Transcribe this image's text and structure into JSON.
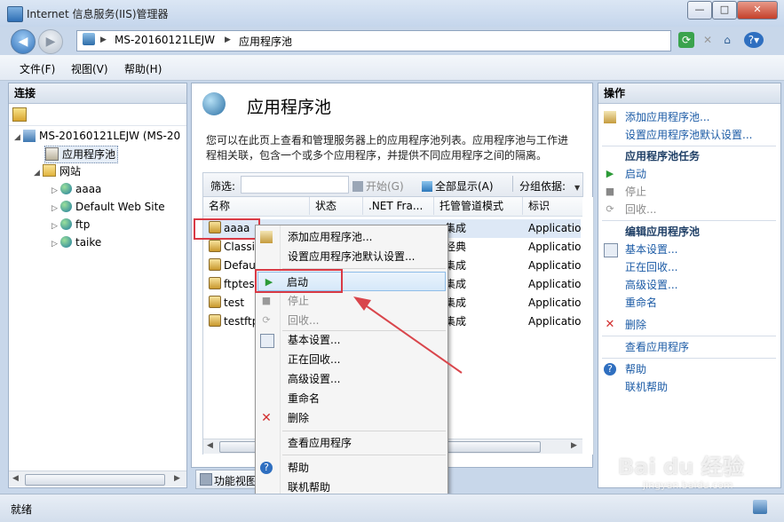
{
  "window": {
    "title": "Internet 信息服务(IIS)管理器",
    "min": "—",
    "max": "□",
    "close": "✕"
  },
  "address": {
    "server": "MS-20160121LEJW",
    "sep": "▶",
    "page": "应用程序池"
  },
  "toolbar": {
    "help": "?▾"
  },
  "menu": [
    "文件(F)",
    "视图(V)",
    "帮助(H)"
  ],
  "connections": {
    "title": "连接",
    "server_node": "MS-20160121LEJW (MS-20",
    "app_pools_node": "应用程序池",
    "sites_node": "网站",
    "sites": [
      "aaaa",
      "Default Web Site",
      "ftp",
      "taike"
    ]
  },
  "main": {
    "title": "应用程序池",
    "description": "您可以在此页上查看和管理服务器上的应用程序池列表。应用程序池与工作进程相关联，包含一个或多个应用程序，并提供不同应用程序之间的隔离。",
    "filter_label": "筛选:",
    "start_label": "开始(G)",
    "show_all_label": "全部显示(A)",
    "group_label": "分组依据:",
    "columns": [
      "名称",
      "状态",
      ".NET Fra...",
      "托管管道模式",
      "标识"
    ],
    "rows": [
      {
        "name": "aaaa",
        "pipeline": "集成",
        "identity": "Applicatio"
      },
      {
        "name": "Classic",
        "pipeline": "经典",
        "identity": "Applicatio"
      },
      {
        "name": "Defau",
        "pipeline": "集成",
        "identity": "Applicatio"
      },
      {
        "name": "ftptest",
        "pipeline": "集成",
        "identity": "Applicatio"
      },
      {
        "name": "test",
        "pipeline": "集成",
        "identity": "Applicatio"
      },
      {
        "name": "testftp",
        "pipeline": "集成",
        "identity": "Applicatio"
      }
    ],
    "feature_view_tab": "功能视图"
  },
  "actions": {
    "title": "操作",
    "add_pool": "添加应用程序池...",
    "set_defaults": "设置应用程序池默认设置...",
    "task_header": "应用程序池任务",
    "start": "启动",
    "stop": "停止",
    "recycle": "回收...",
    "edit_header": "编辑应用程序池",
    "basic": "基本设置...",
    "recycling": "正在回收...",
    "advanced": "高级设置...",
    "rename": "重命名",
    "delete": "删除",
    "view_apps": "查看应用程序",
    "help": "帮助",
    "online_help": "联机帮助"
  },
  "context_menu": [
    "添加应用程序池...",
    "设置应用程序池默认设置...",
    "启动",
    "停止",
    "回收...",
    "基本设置...",
    "正在回收...",
    "高级设置...",
    "重命名",
    "删除",
    "查看应用程序",
    "帮助",
    "联机帮助"
  ],
  "status": {
    "text": "就绪"
  },
  "watermark": {
    "brand": "Bai du 经验",
    "url": "jingyan.baidu.com"
  },
  "colors": {
    "highlight": "#d93a45",
    "link": "#1a5aa5",
    "arrow": "#d9464c"
  }
}
